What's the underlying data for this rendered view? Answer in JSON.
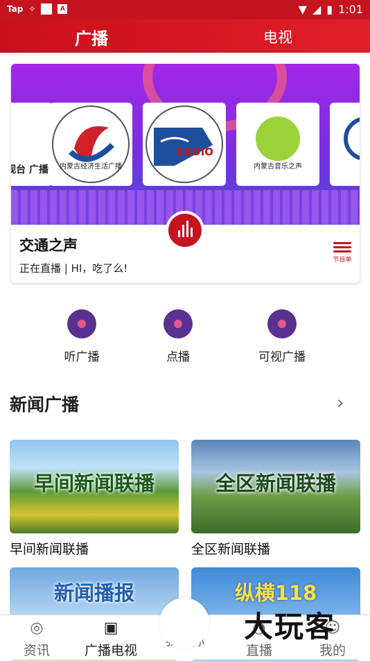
{
  "status_bar": {
    "left_text": "Tap",
    "time": "1:01"
  },
  "top_tabs": [
    {
      "label": "广播"
    },
    {
      "label": "电视"
    }
  ],
  "banner": {
    "logos": [
      {
        "label": "电视台 广播"
      },
      {
        "label": "内蒙古经济生活广播"
      },
      {
        "label": "RADIO"
      },
      {
        "label": "内蒙古音乐之声"
      },
      {
        "label": ""
      }
    ],
    "station_title": "交通之声",
    "station_status": "正在直播 | HI，吃了么!",
    "schedule_label": "节目单"
  },
  "quick_actions": [
    {
      "label": "听广播",
      "icon": "music-disc-icon"
    },
    {
      "label": "点播",
      "icon": "tap-disc-icon"
    },
    {
      "label": "可视广播",
      "icon": "video-disc-icon"
    }
  ],
  "section": {
    "title": "新闻广播",
    "more_icon": "chevron-right-icon"
  },
  "cards": [
    {
      "overlay": "早间新闻联播",
      "caption": "早间新闻联播"
    },
    {
      "overlay": "全区新闻联播",
      "caption": "全区新闻联播"
    },
    {
      "overlay": "新闻播报",
      "caption": ""
    },
    {
      "overlay": "纵横118",
      "caption": ""
    }
  ],
  "bottom_nav": [
    {
      "label": "资讯",
      "icon": "planet-icon"
    },
    {
      "label": "广播电视",
      "icon": "radio-icon"
    },
    {
      "label": "我帮你",
      "icon": "headset-icon"
    },
    {
      "label": "直播",
      "icon": "live-icon"
    },
    {
      "label": "我的",
      "icon": "user-icon"
    }
  ],
  "watermark": "大玩客",
  "colors": {
    "brand_red": "#c4141f",
    "banner_purple": "#8a2be2"
  }
}
